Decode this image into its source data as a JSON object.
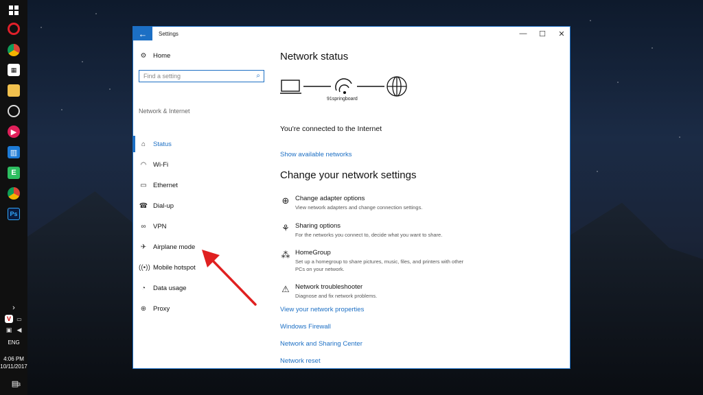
{
  "taskbar": {
    "lang": "ENG",
    "time": "4:06 PM",
    "date": "10/11/2017",
    "notification_count": "3"
  },
  "window": {
    "title": "Settings",
    "back_icon": "←",
    "minimize": "—",
    "maximize": "☐",
    "close": "✕"
  },
  "nav": {
    "home": "Home",
    "search_placeholder": "Find a setting",
    "section": "Network & Internet",
    "items": [
      {
        "label": "Status",
        "icon": "status-icon"
      },
      {
        "label": "Wi-Fi",
        "icon": "wifi-icon"
      },
      {
        "label": "Ethernet",
        "icon": "ethernet-icon"
      },
      {
        "label": "Dial-up",
        "icon": "dialup-icon"
      },
      {
        "label": "VPN",
        "icon": "vpn-icon"
      },
      {
        "label": "Airplane mode",
        "icon": "airplane-icon"
      },
      {
        "label": "Mobile hotspot",
        "icon": "hotspot-icon"
      },
      {
        "label": "Data usage",
        "icon": "data-usage-icon"
      },
      {
        "label": "Proxy",
        "icon": "proxy-icon"
      }
    ]
  },
  "main": {
    "status_heading": "Network status",
    "network_name": "91springboard",
    "connected_text": "You're connected to the Internet",
    "show_networks": "Show available networks",
    "change_heading": "Change your network settings",
    "options": [
      {
        "title": "Change adapter options",
        "desc": "View network adapters and change connection settings."
      },
      {
        "title": "Sharing options",
        "desc": "For the networks you connect to, decide what you want to share."
      },
      {
        "title": "HomeGroup",
        "desc": "Set up a homegroup to share pictures, music, files, and printers with other PCs on your network."
      },
      {
        "title": "Network troubleshooter",
        "desc": "Diagnose and fix network problems."
      }
    ],
    "links": [
      "View your network properties",
      "Windows Firewall",
      "Network and Sharing Center",
      "Network reset"
    ]
  },
  "colors": {
    "accent": "#1c6fc4",
    "arrow": "#e02020"
  }
}
